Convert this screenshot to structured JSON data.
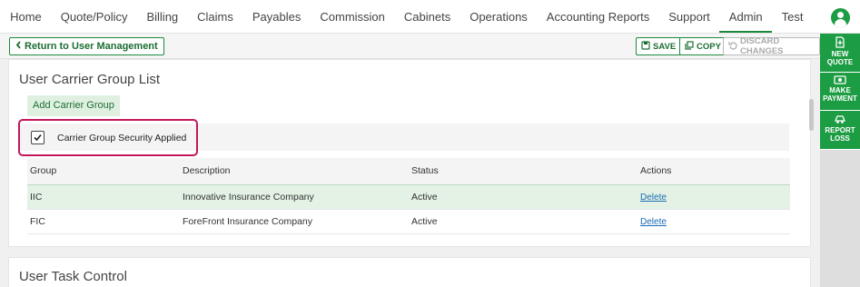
{
  "nav": {
    "items": [
      "Home",
      "Quote/Policy",
      "Billing",
      "Claims",
      "Payables",
      "Commission",
      "Cabinets",
      "Operations",
      "Accounting Reports",
      "Support",
      "Admin",
      "Test"
    ],
    "active": "Admin"
  },
  "toolbar": {
    "return_label": "Return to User Management",
    "save_label": "SAVE",
    "copy_label": "COPY",
    "discard_label": "DISCARD CHANGES"
  },
  "side": {
    "new_quote": "NEW QUOTE",
    "make_payment": "MAKE PAYMENT",
    "report_loss": "REPORT LOSS"
  },
  "carrier_group": {
    "title": "User Carrier Group List",
    "add_label": "Add Carrier Group",
    "security_label": "Carrier Group Security Applied",
    "security_checked": true,
    "columns": [
      "Group",
      "Description",
      "Status",
      "Actions"
    ],
    "rows": [
      {
        "group": "IIC",
        "description": "Innovative Insurance Company",
        "status": "Active",
        "action": "Delete"
      },
      {
        "group": "FIC",
        "description": "ForeFront Insurance Company",
        "status": "Active",
        "action": "Delete"
      }
    ]
  },
  "task_control": {
    "title": "User Task Control"
  },
  "colors": {
    "accent": "#1c9c43",
    "highlight_border": "#c2185b",
    "row_highlight": "#e3f2e5"
  }
}
